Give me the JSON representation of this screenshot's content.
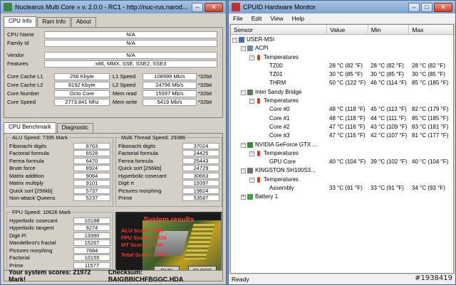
{
  "nmc": {
    "title": "Nuclearus Multi Core  »  v. 2.0.0  -  RC1  -  http://nuc-rus.narod...",
    "tabs": [
      "CPU Info",
      "Ram Info",
      "About"
    ],
    "cpu": {
      "cpu_name_label": "CPU Name",
      "cpu_name": "N/A",
      "family_id_label": "Family Id",
      "family_id": "N/A",
      "vendor_label": "Vendor",
      "vendor": "N/A",
      "features_label": "Features",
      "features": "x86, MMX, SSE, SSE2, SSE3"
    },
    "specs_left": [
      {
        "label": "Core Cache L1",
        "value": "256 Kbyte"
      },
      {
        "label": "Core Cache L2",
        "value": "8192 Kbyte"
      },
      {
        "label": "Core Number",
        "value": "Octo Core"
      },
      {
        "label": "Core Speed",
        "value": "2773.841 Mhz"
      }
    ],
    "specs_right": [
      {
        "label": "L1 Speed",
        "value": "108999 Mb/s",
        "unit": "*32bit"
      },
      {
        "label": "L2 Speed",
        "value": "24796 Mb/s",
        "unit": "*32bit"
      },
      {
        "label": "Mem read",
        "value": "15597 Mb/s",
        "unit": "*32bit"
      },
      {
        "label": "Mem write",
        "value": "5419 Mb/s",
        "unit": "*32bit"
      }
    ],
    "tabs2": [
      "CPU Benchmark",
      "Diagnostic"
    ],
    "alu": {
      "title": "ALU Speed: 7395 Mark",
      "rows": [
        {
          "label": "Fibonachi digits",
          "value": "8763"
        },
        {
          "label": "Factorial formula",
          "value": "6528"
        },
        {
          "label": "Ferma formula",
          "value": "6470"
        },
        {
          "label": "Brute force",
          "value": "8924"
        },
        {
          "label": "Matrix addition",
          "value": "9064"
        },
        {
          "label": "Matrix multiply",
          "value": "9101"
        },
        {
          "label": "Quick sort [256kb]",
          "value": "5737"
        },
        {
          "label": "Non-attack Queens",
          "value": "5237"
        }
      ]
    },
    "mt": {
      "title": "Multi Thread Speed: 29386",
      "rows": [
        {
          "label": "Fibonachi digits",
          "value": "37024"
        },
        {
          "label": "Factorial formula",
          "value": "24425"
        },
        {
          "label": "Ferma formula",
          "value": "25443"
        },
        {
          "label": "Quick sort [256kb]",
          "value": "24729"
        },
        {
          "label": "Hyperbolic cosecant",
          "value": "30663"
        },
        {
          "label": "Digit π",
          "value": "19397"
        },
        {
          "label": "Pictures morphing",
          "value": "19824"
        },
        {
          "label": "Prime",
          "value": "53587"
        }
      ]
    },
    "fpu": {
      "title": "FPU Speed: 10626 Mark",
      "rows": [
        {
          "label": "Hyperbolic cosecant",
          "value": "10188"
        },
        {
          "label": "Hyperbolic tangent",
          "value": "9274"
        },
        {
          "label": "Digit Pi",
          "value": "13390"
        },
        {
          "label": "Mandelbrot's fractal",
          "value": "15267"
        },
        {
          "label": "Pictures morphing",
          "value": "7684"
        },
        {
          "label": "Factorial",
          "value": "10155"
        },
        {
          "label": "Prime",
          "value": "11577"
        },
        {
          "label": "Digit e",
          "value": "7478"
        }
      ]
    },
    "results": {
      "title": "System results",
      "alu": "ALU Score: 7395",
      "fpu": "FPU Score: 10626",
      "mt": "MT Score: 29386",
      "total": "Total Score: 21972",
      "run": "RUN",
      "close": "CLOSE"
    },
    "bottom": {
      "scores": "Your system scores: 21972 Mark!",
      "checksum": "Checksum: BAIGBBICHFBGGC.HDA"
    }
  },
  "hwm": {
    "title": "CPUID Hardware Monitor",
    "menu": [
      "File",
      "Edit",
      "View",
      "Help"
    ],
    "columns": [
      "Sensor",
      "Value",
      "Min",
      "Max"
    ],
    "tree": [
      {
        "level": 0,
        "icon": "computer-icon",
        "name": "USER-MSI",
        "exp": "−"
      },
      {
        "level": 1,
        "icon": "acpi-icon",
        "name": "ACPI",
        "exp": "−"
      },
      {
        "level": 2,
        "icon": "thermometer-icon",
        "name": "Temperatures",
        "exp": "−"
      },
      {
        "level": 3,
        "name": "TZ00",
        "value": "28 °C  (82 °F)",
        "min": "28 °C  (82 °F)",
        "max": "28 °C  (82 °F)"
      },
      {
        "level": 3,
        "name": "TZ01",
        "value": "30 °C  (85 °F)",
        "min": "30 °C  (85 °F)",
        "max": "30 °C  (85 °F)"
      },
      {
        "level": 3,
        "name": "THRM",
        "value": "50 °C  (122 °F)",
        "min": "46 °C  (114 °F)",
        "max": "85 °C  (185 °F)"
      },
      {
        "level": 1,
        "icon": "cpu-icon",
        "name": "Intel Sandy Bridge",
        "exp": "−"
      },
      {
        "level": 2,
        "icon": "thermometer-icon",
        "name": "Temperatures",
        "exp": "−"
      },
      {
        "level": 3,
        "name": "Core #0",
        "value": "48 °C  (118 °F)",
        "min": "45 °C  (113 °F)",
        "max": "82 °C  (179 °F)"
      },
      {
        "level": 3,
        "name": "Core #1",
        "value": "48 °C  (118 °F)",
        "min": "44 °C  (111 °F)",
        "max": "85 °C  (185 °F)"
      },
      {
        "level": 3,
        "name": "Core #2",
        "value": "47 °C  (116 °F)",
        "min": "43 °C  (109 °F)",
        "max": "83 °C  (181 °F)"
      },
      {
        "level": 3,
        "name": "Core #3",
        "value": "47 °C  (116 °F)",
        "min": "42 °C  (107 °F)",
        "max": "81 °C  (177 °F)"
      },
      {
        "level": 1,
        "icon": "gpu-icon",
        "name": "NVIDIA GeForce GTX ...",
        "exp": "−"
      },
      {
        "level": 2,
        "icon": "thermometer-icon",
        "name": "Temperatures",
        "exp": "−"
      },
      {
        "level": 3,
        "name": "GPU Core",
        "value": "40 °C  (104 °F)",
        "min": "39 °C  (102 °F)",
        "max": "40 °C  (104 °F)"
      },
      {
        "level": 1,
        "icon": "disk-icon",
        "name": "KINGSTON  SH100S3...",
        "exp": "−"
      },
      {
        "level": 2,
        "icon": "thermometer-icon",
        "name": "Temperatures",
        "exp": "−"
      },
      {
        "level": 3,
        "name": "Assembly",
        "value": "33 °C  (91 °F)",
        "min": "33 °C  (91 °F)",
        "max": "34 °C  (93 °F)"
      },
      {
        "level": 1,
        "icon": "battery-icon",
        "name": "Battery 1",
        "exp": "+"
      }
    ],
    "status": "Ready",
    "watermark": "#1938419"
  }
}
